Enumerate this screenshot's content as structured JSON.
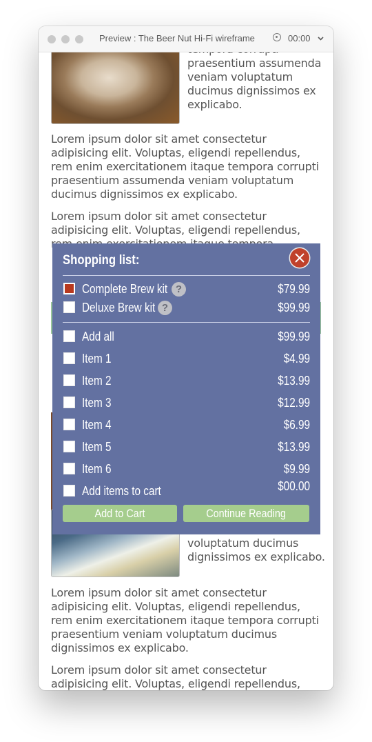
{
  "window": {
    "title": "Preview : The Beer Nut Hi-Fi wireframe",
    "timer": "00:00"
  },
  "article": {
    "side_text_1": "tempora corrupti praesentium assumenda veniam voluptatum ducimus dignissimos ex explicabo.",
    "para_1": "Lorem ipsum dolor sit amet consectetur adipisicing elit. Voluptas, eligendi repellendus, rem enim exercitationem itaque tempora corrupti praesentium assumenda veniam voluptatum ducimus dignissimos ex explicabo.",
    "para_2": "Lorem ipsum dolor sit amet consectetur adipisicing elit. Voluptas, eligendi repellendus, rem enim exercitationem itaque tempora",
    "side_text_2": "voluptatum ducimus dignissimos ex explicabo.",
    "para_3": "Lorem ipsum dolor sit amet consectetur adipisicing elit. Voluptas, eligendi repellendus, rem enim exercitationem itaque tempora corrupti praesentium veniam voluptatum ducimus dignissimos ex explicabo.",
    "para_4": "Lorem ipsum dolor sit amet consectetur adipisicing elit. Voluptas, eligendi repellendus,"
  },
  "modal": {
    "title": "Shopping list:",
    "kits": [
      {
        "label": "Complete Brew kit",
        "price": "$79.99",
        "checked": true,
        "help": "?"
      },
      {
        "label": "Deluxe Brew kit",
        "price": "$99.99",
        "checked": false,
        "help": "?"
      }
    ],
    "items": [
      {
        "label": "Add all",
        "price": "$99.99"
      },
      {
        "label": "Item 1",
        "price": "$4.99"
      },
      {
        "label": "Item 2",
        "price": "$13.99"
      },
      {
        "label": "Item 3",
        "price": "$12.99"
      },
      {
        "label": "Item 4",
        "price": "$6.99"
      },
      {
        "label": "Item 5",
        "price": "$13.99"
      },
      {
        "label": "Item 6",
        "price": "$9.99"
      },
      {
        "label": "Add items to cart",
        "price": "$00.00"
      }
    ],
    "add_to_cart": "Add to Cart",
    "continue_reading": "Continue Reading"
  },
  "colors": {
    "modal_bg": "#6371a1",
    "close_button": "#c0412b",
    "checked_box": "#b8391f",
    "action_button": "#a5cd8d"
  }
}
